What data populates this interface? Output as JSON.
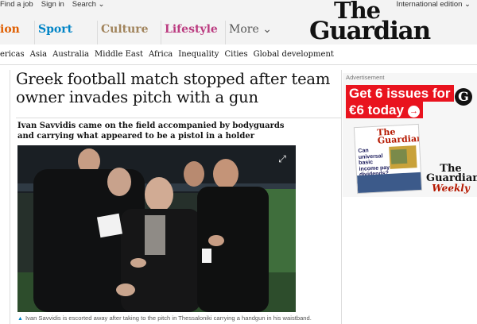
{
  "topbar": {
    "links": [
      "Find a job",
      "Sign in",
      "Search ⌄"
    ],
    "edition": "International edition ⌄",
    "logo_line1": "The",
    "logo_line2": "Guardian"
  },
  "pillars": [
    {
      "label": "ion",
      "color": "#e05e00"
    },
    {
      "label": "Sport",
      "color": "#0084c6"
    },
    {
      "label": "Culture",
      "color": "#a1845c"
    },
    {
      "label": "Lifestyle",
      "color": "#bb3b80"
    },
    {
      "label": "More ⌄",
      "color": "#555555"
    }
  ],
  "subnav": [
    "ericas",
    "Asia",
    "Australia",
    "Middle East",
    "Africa",
    "Inequality",
    "Cities",
    "Global development"
  ],
  "article": {
    "headline": "Greek football match stopped after team owner invades pitch with a gun",
    "standfirst": "Ivan Savvidis came on the field accompanied by bodyguards and carrying what appeared to be a pistol in a holder",
    "caption_icon": "triangle-icon",
    "caption": "Ivan Savvidis is escorted away after taking to the pitch in Thessaloniki carrying a handgun in his waistband.",
    "expand_icon": "expand-icon"
  },
  "ad": {
    "label": "Advertisement",
    "line1": "Get 6 issues for",
    "line2": "€6 today",
    "arrow": "→",
    "g_icon": "G",
    "mag_masthead_1": "The",
    "mag_masthead_2": "Guardian",
    "mag_text": "Can universal basic income pay dividends?",
    "weekly_1": "The",
    "weekly_2": "Guardian",
    "weekly_3": "Weekly"
  },
  "colors": {
    "accent_red": "#e9131e",
    "sport": "#0084c6",
    "culture": "#a1845c",
    "lifestyle": "#bb3b80",
    "opinion": "#e05e00"
  }
}
